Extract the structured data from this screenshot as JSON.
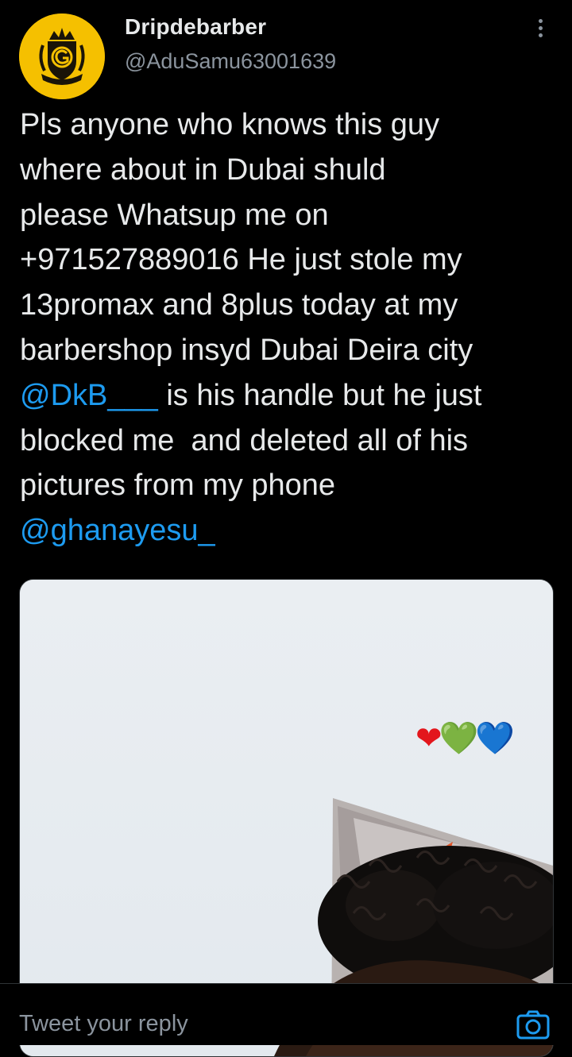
{
  "author": {
    "display_name": "Dripdebarber",
    "handle": "@AduSamu63001639",
    "avatar_color": "#f5c000"
  },
  "tweet": {
    "text_parts": {
      "p1": "Pls anyone who knows this guy\nwhere about in Dubai shuld\nplease Whatsup me on\n+971527889016 He just stole my\n13promax and 8plus today at my\nbarbershop insyd Dubai Deira city\n",
      "mention1": "@DkB___",
      "p2": " is his handle but he just\nblocked me  and deleted all of his\npictures from my phone\n",
      "mention2": "@ghanayesu_"
    }
  },
  "media": {
    "emojis": {
      "red": "❤",
      "green": "💚",
      "blue": "💙"
    }
  },
  "reply": {
    "placeholder": "Tweet your reply"
  },
  "icons": {
    "more": "more-vertical-icon",
    "camera": "camera-icon"
  },
  "colors": {
    "background": "#000000",
    "text": "#e7e9ea",
    "secondary": "#8b949e",
    "link": "#1d9bf0"
  }
}
